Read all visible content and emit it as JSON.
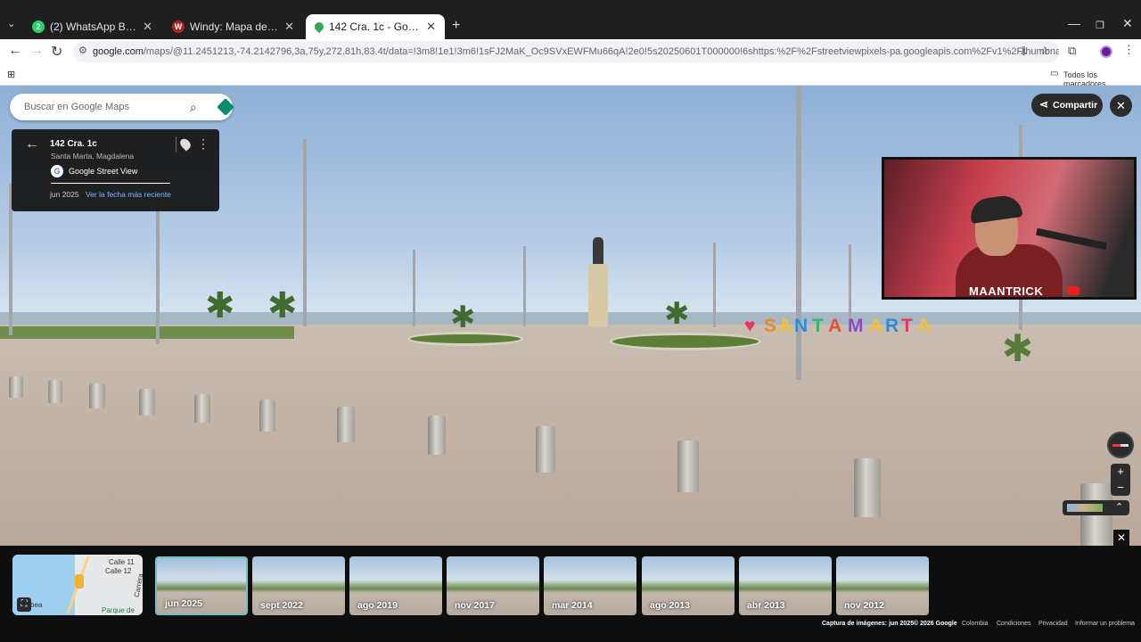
{
  "browser": {
    "tabs": [
      {
        "title": "(2) WhatsApp Business",
        "badge": "2",
        "favicon_color": "#25D366"
      },
      {
        "title": "Windy: Mapa de viento y pronó",
        "badge": "W",
        "favicon_color": "#b22222"
      },
      {
        "title": "142 Cra. 1c - Google Maps",
        "badge": "",
        "favicon_color": "#34a853"
      }
    ],
    "new_tab": "+",
    "url_domain": "google.com",
    "url_rest": "/maps/@11.2451213,-74.2142796,3a,75y,272.81h,83.4t/data=!3m8!1e1!3m6!1sFJ2MaK_Oc9SVxEWFMu66qA!2e0!5s20250601T000000!6shttps:%2F%2Fstreetviewpixels-pa.googleapis.com%2Fv1%2Fthumbnail%3Fcb_client%3Dmaps_sv.tacti...",
    "bookmarks_label": "Todos los marcadores"
  },
  "maps": {
    "search_placeholder": "Buscar en Google Maps",
    "place": {
      "name": "142 Cra. 1c",
      "city": "Santa Marta, Magdalena",
      "source": "Google Street View",
      "date": "jun 2025",
      "latest_link": "Ver la fecha más reciente"
    },
    "share_label": "Compartir",
    "close_symbol": "✕",
    "zoom_in": "+",
    "zoom_out": "−"
  },
  "scene": {
    "sign_letters": [
      "♥",
      "S",
      "A",
      "N",
      "T",
      "A",
      "M",
      "A",
      "R",
      "T",
      "A"
    ]
  },
  "webcam": {
    "label": "MAANTRICK"
  },
  "minimap": {
    "labels": [
      "Calle 11",
      "Calle 12",
      "Carrera",
      "Parque de",
      "bea"
    ]
  },
  "timeline": [
    {
      "label": "jun 2025",
      "active": true
    },
    {
      "label": "sept 2022",
      "active": false
    },
    {
      "label": "ago 2019",
      "active": false
    },
    {
      "label": "nov 2017",
      "active": false
    },
    {
      "label": "mar 2014",
      "active": false
    },
    {
      "label": "ago 2013",
      "active": false
    },
    {
      "label": "abr 2013",
      "active": false
    },
    {
      "label": "nov 2012",
      "active": false
    }
  ],
  "footer": {
    "capture": "Captura de imágenes: jun 2025",
    "copyright": "© 2026 Google",
    "country": "Colombia",
    "terms": "Condiciones",
    "privacy": "Privacidad",
    "report": "Informar un problema"
  }
}
